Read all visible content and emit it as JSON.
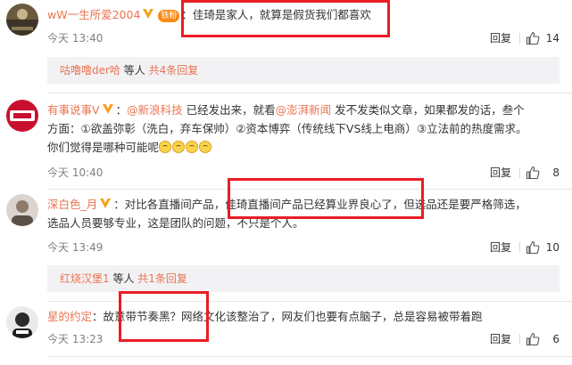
{
  "comments": [
    {
      "username": "wW一生所爱2004",
      "fan_badge": "铁粉",
      "text": "：佳琦是家人，就算是假货我们都喜欢",
      "time": "今天 13:40",
      "reply_label": "回复",
      "likes": "14",
      "thread": {
        "who": "咕噜噜der哈",
        "mid": " 等人 ",
        "total": "共4条回复"
      }
    },
    {
      "username": "有事说事V",
      "text_prefix": "：",
      "mention1": "@新浪科技",
      "text_mid1": " 已经发出来，就看",
      "mention2": "@澎湃新闻",
      "text_mid2": " 发不发类似文章，如果都发的话，叁个",
      "line2": "方面：①欲盖弥彰（洗白，弃车保帅）②资本博弈（传统线下VS线上电商）③立法前的热度需求。",
      "line3": "你们觉得是哪种可能呢",
      "time": "今天 10:40",
      "reply_label": "回复",
      "likes": "8"
    },
    {
      "username": "深白色_月",
      "line1": "：对比各直播间产品，佳琦直播间产品已经算业界良心了，但选品还是要严格筛选，",
      "line2": "选品人员要够专业，这是团队的问题，不只是个人。",
      "time": "今天 13:49",
      "reply_label": "回复",
      "likes": "10",
      "thread": {
        "who": "红烧汉堡1",
        "mid": " 等人 ",
        "total": "共1条回复"
      }
    },
    {
      "username": "星的约定",
      "text": "：故意带节奏黑？网络文化该整治了，网友们也要有点脑子，总是容易被带着跑",
      "time": "今天 13:23",
      "reply_label": "回复",
      "likes": "6"
    }
  ],
  "colors": {
    "link": "#eb7350",
    "highlight_box": "#ea1c24",
    "thread_bg": "#f2f2f5"
  },
  "icons": {
    "like": "thumbs-up-icon",
    "vip": "vip-v-icon"
  }
}
